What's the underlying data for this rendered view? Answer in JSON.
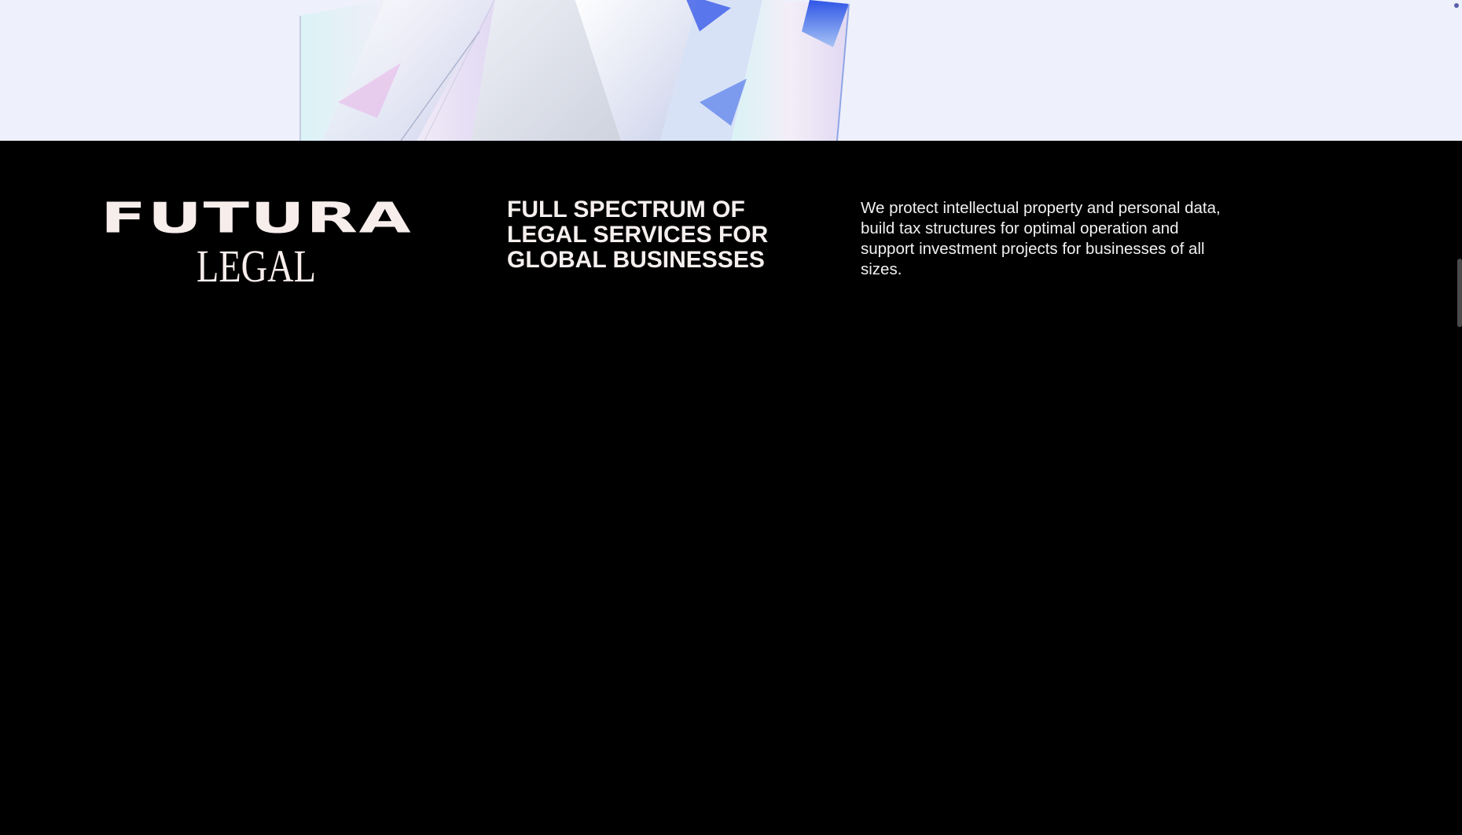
{
  "hero": {
    "image": "crystal-image",
    "background_color": "#eef1fb"
  },
  "footer": {
    "logo": {
      "line1": "FUTURA",
      "line2": "LEGAL"
    },
    "tagline": "FULL SPECTRUM OF LEGAL SERVICES FOR GLOBAL BUSINESSES",
    "description": "We protect intellectual property and personal data, build tax structures for optimal operation and support investment projects for businesses of all sizes.",
    "background_color": "#000000",
    "text_color": "#f5efee"
  }
}
